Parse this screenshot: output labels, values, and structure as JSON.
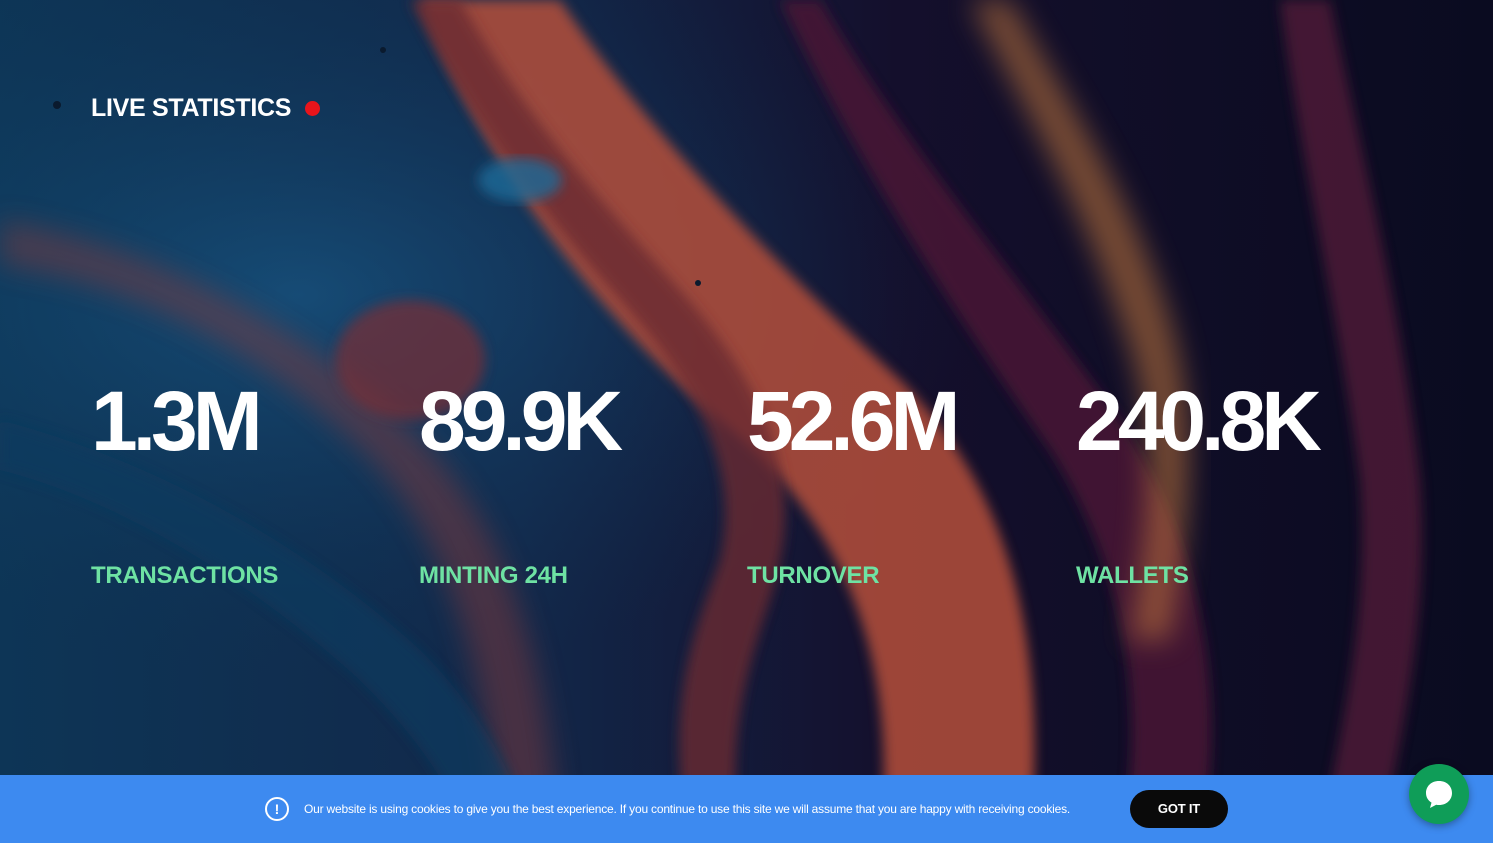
{
  "header": {
    "title": "LIVE STATISTICS",
    "live_indicator_color": "#e8141b"
  },
  "stats": [
    {
      "value": "1.3M",
      "label": "TRANSACTIONS"
    },
    {
      "value": "89.9K",
      "label": "MINTING 24H"
    },
    {
      "value": "52.6M",
      "label": "TURNOVER"
    },
    {
      "value": "240.8K",
      "label": "WALLETS"
    }
  ],
  "cookie_banner": {
    "message": "Our website is using cookies to give you the best experience. If you continue to use this site we will assume that you are happy with receiving cookies.",
    "button_label": "GOT IT",
    "icon": "info-circle-icon",
    "background_color": "#3d8af0"
  },
  "chat_widget": {
    "icon": "chat-bubble-icon",
    "color": "#0f9d58"
  },
  "colors": {
    "label_accent": "#6ee2a3",
    "value_text": "#ffffff"
  }
}
